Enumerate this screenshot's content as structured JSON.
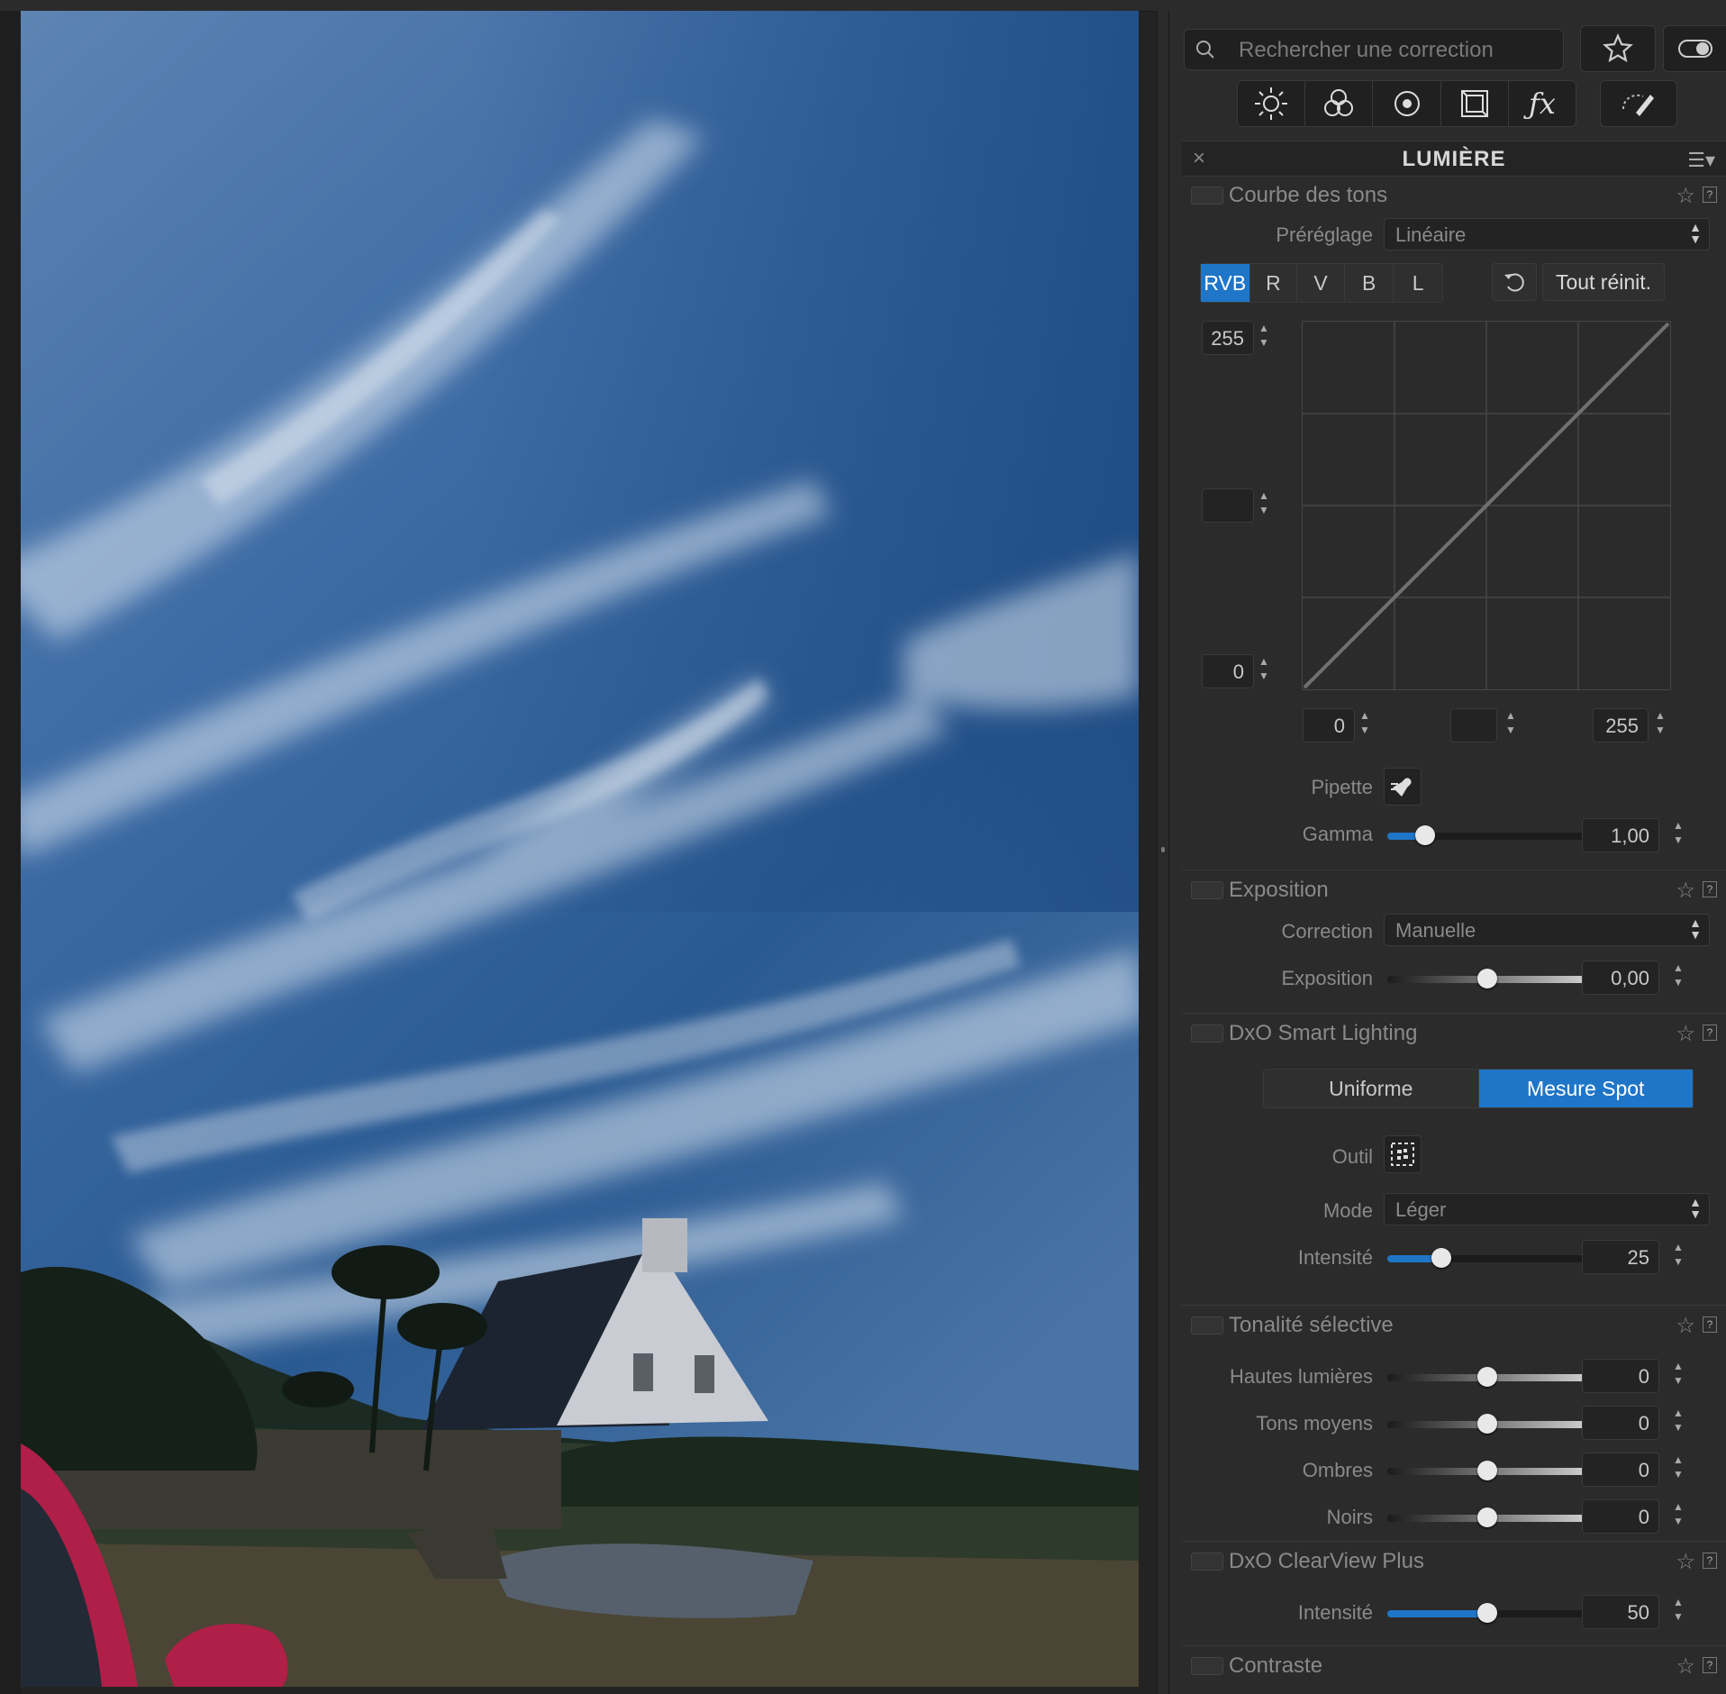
{
  "search": {
    "placeholder": "Rechercher une correction"
  },
  "palette": {
    "title": "LUMIÈRE",
    "close_glyph": "×",
    "menu_glyph": "☰▾"
  },
  "tone_curve": {
    "name": "Courbe des tons",
    "preset_label": "Préréglage",
    "preset_value": "Linéaire",
    "channels": [
      "RVB",
      "R",
      "V",
      "B",
      "L"
    ],
    "active_channel": "RVB",
    "reset_all": "Tout réinit.",
    "out_max": "255",
    "out_min": "0",
    "in_min": "0",
    "in_max": "255",
    "pipette_label": "Pipette",
    "gamma_label": "Gamma",
    "gamma_value": "1,00",
    "gamma_level": 0.19
  },
  "exposure": {
    "name": "Exposition",
    "correction_label": "Correction",
    "correction_value": "Manuelle",
    "exposure_label": "Exposition",
    "exposure_value": "0,00",
    "exposure_level": 0.5
  },
  "smart_lighting": {
    "name": "DxO Smart Lighting",
    "modes": [
      "Uniforme",
      "Mesure Spot"
    ],
    "active_mode": "Mesure Spot",
    "tool_label": "Outil",
    "mode_label": "Mode",
    "mode_value": "Léger",
    "intensity_label": "Intensité",
    "intensity_value": "25",
    "intensity_level": 0.27
  },
  "selective_tone": {
    "name": "Tonalité sélective",
    "rows": [
      {
        "label": "Hautes lumières",
        "value": "0",
        "level": 0.5
      },
      {
        "label": "Tons moyens",
        "value": "0",
        "level": 0.5
      },
      {
        "label": "Ombres",
        "value": "0",
        "level": 0.5
      },
      {
        "label": "Noirs",
        "value": "0",
        "level": 0.5
      }
    ]
  },
  "clearview": {
    "name": "DxO ClearView Plus",
    "intensity_label": "Intensité",
    "intensity_value": "50",
    "intensity_level": 0.5
  },
  "contrast": {
    "name": "Contraste"
  },
  "colors": {
    "accent": "#1f76c8",
    "panel": "#2b2b2b",
    "sky": "#2a5a92"
  },
  "icons": [
    "search-icon",
    "star-icon",
    "toggle-icon",
    "sun-icon",
    "color-circles-icon",
    "detail-icon",
    "geometry-icon",
    "fx-icon",
    "brush-icon",
    "reset-icon",
    "pipette-icon",
    "spot-tool-icon"
  ]
}
